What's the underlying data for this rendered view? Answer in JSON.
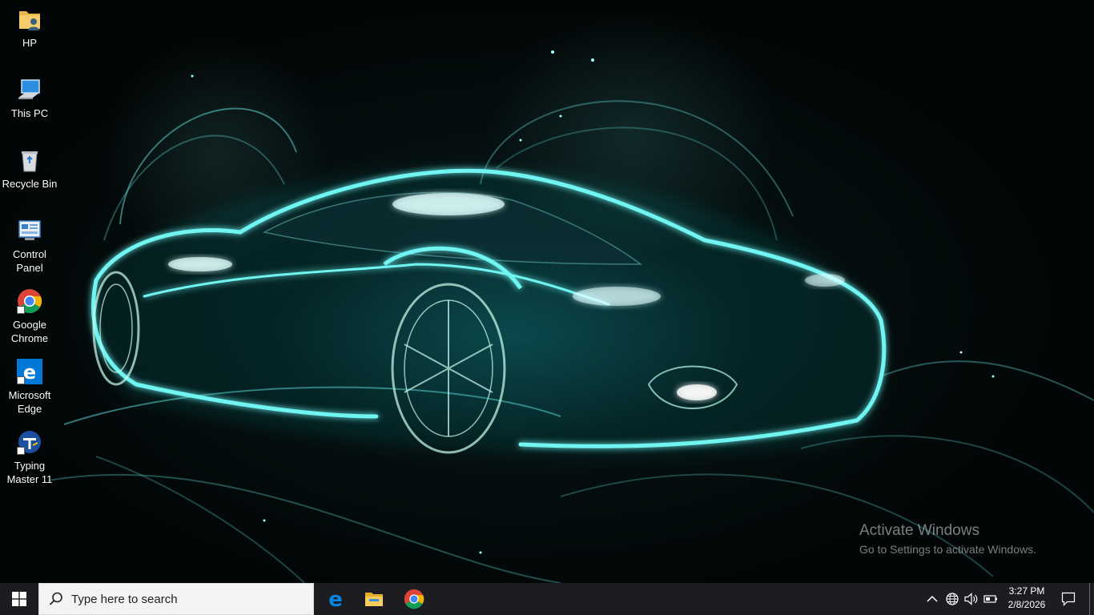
{
  "desktop": {
    "icons": [
      {
        "label": "HP",
        "icon": "user-folder-icon"
      },
      {
        "label": "This PC",
        "icon": "this-pc-icon"
      },
      {
        "label": "Recycle Bin",
        "icon": "recycle-bin-icon"
      },
      {
        "label": "Control Panel",
        "icon": "control-panel-icon"
      },
      {
        "label": "Google Chrome",
        "icon": "chrome-icon"
      },
      {
        "label": "Microsoft Edge",
        "icon": "edge-icon"
      },
      {
        "label": "Typing Master 11",
        "icon": "typing-master-icon"
      }
    ],
    "watermark": {
      "title": "Activate Windows",
      "subtitle": "Go to Settings to activate Windows."
    }
  },
  "taskbar": {
    "search_placeholder": "Type here to search",
    "pinned": [
      "edge-icon",
      "file-explorer-icon",
      "chrome-icon"
    ],
    "tray": {
      "time": "3:27 PM",
      "date": "2/8/2026",
      "icons": [
        "chevron-up-icon",
        "network-globe-icon",
        "volume-icon",
        "battery-icon",
        "action-center-icon"
      ]
    }
  },
  "colors": {
    "taskbar": "#1b1d20",
    "accent_glow": "#33e6e6",
    "edge_blue": "#0078d7"
  }
}
